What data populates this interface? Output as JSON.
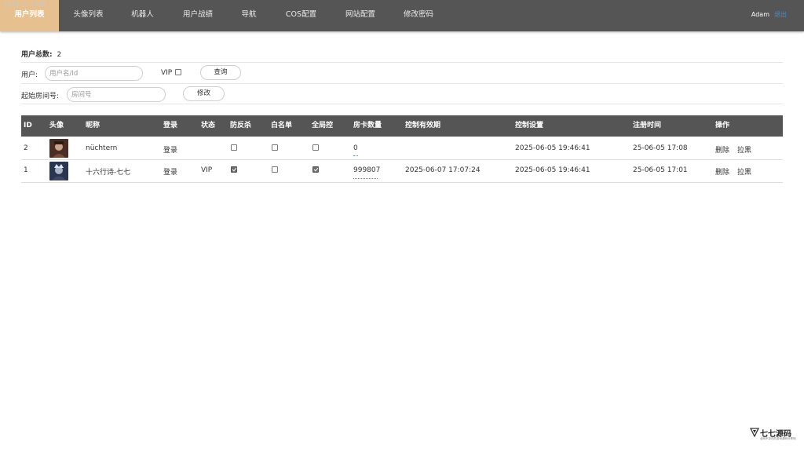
{
  "dimension_label": "1920 x 1080",
  "nav": {
    "items": [
      {
        "label": "用户列表",
        "active": true
      },
      {
        "label": "头像列表",
        "active": false
      },
      {
        "label": "机器人",
        "active": false
      },
      {
        "label": "用户战绩",
        "active": false
      },
      {
        "label": "导航",
        "active": false
      },
      {
        "label": "COS配置",
        "active": false
      },
      {
        "label": "网站配置",
        "active": false
      },
      {
        "label": "修改密码",
        "active": false
      }
    ],
    "username": "Adam",
    "logout": "退出"
  },
  "summary": {
    "label": "用户总数:",
    "value": "2"
  },
  "search": {
    "user_label": "用户:",
    "user_placeholder": "用户名/Id",
    "vip_label": "VIP",
    "query_button": "查询"
  },
  "room": {
    "label": "起始房间号:",
    "placeholder": "房间号",
    "modify_button": "修改"
  },
  "table": {
    "headers": {
      "id": "ID",
      "avatar": "头像",
      "nickname": "昵称",
      "login": "登录",
      "status": "状态",
      "anti_kill": "防反杀",
      "whitelist": "白名单",
      "global_control": "全局控",
      "cards": "房卡数量",
      "control_expiry": "控制有效期",
      "control_settings": "控制设置",
      "register_time": "注册时间",
      "actions": "操作"
    },
    "rows": [
      {
        "id": "2",
        "nickname": "nüchtern",
        "login": "登录",
        "status": "",
        "anti_kill": false,
        "whitelist": false,
        "global_control": false,
        "cards": "0",
        "control_expiry": "",
        "control_settings": "2025-06-05 19:46:41",
        "register_time": "25-06-05 17:08",
        "delete": "删除",
        "block": "拉黑",
        "avatar_palette": [
          "#7a4a3a",
          "#c9a58a"
        ]
      },
      {
        "id": "1",
        "nickname": "十六行诗-七七",
        "login": "登录",
        "status": "VIP",
        "anti_kill": true,
        "whitelist": false,
        "global_control": true,
        "cards": "999807",
        "control_expiry": "2025-06-07 17:07:24",
        "control_settings": "2025-06-05 19:46:41",
        "register_time": "25-06-05 17:01",
        "delete": "删除",
        "block": "拉黑",
        "avatar_palette": [
          "#3a4a66",
          "#aab4c8"
        ]
      }
    ]
  },
  "watermark": {
    "text": "七七源码",
    "sub": "全网不存在的游戏源码分享网"
  },
  "colors": {
    "topbar": "#555555",
    "active_tab": "#e7c08f",
    "link": "#3b8fd9"
  }
}
